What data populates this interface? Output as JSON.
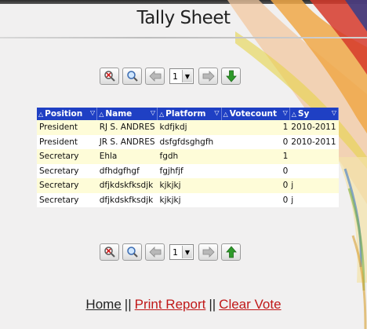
{
  "page": {
    "title": "Tally Sheet"
  },
  "toolbar": {
    "buttons": [
      "search-clear-icon",
      "search-icon",
      "prev-arrow-icon",
      "next-arrow-icon"
    ],
    "page_value": "1",
    "top_nav_icon": "down-arrow-icon",
    "bottom_nav_icon": "up-arrow-icon"
  },
  "table": {
    "columns": [
      "Position",
      "Name",
      "Platform",
      "Votecount",
      "Sy"
    ],
    "rows": [
      {
        "position": "President",
        "name": "RJ S. ANDRES",
        "platform": "kdfjkdj",
        "votecount": "1",
        "sy": "2010-2011"
      },
      {
        "position": "President",
        "name": "JR S. ANDRES",
        "platform": "dsfgfdsghgfh",
        "votecount": "0",
        "sy": "2010-2011"
      },
      {
        "position": "Secretary",
        "name": "Ehla",
        "platform": "fgdh",
        "votecount": "1",
        "sy": ""
      },
      {
        "position": "Secretary",
        "name": "dfhdgfhgf",
        "platform": "fgjhfjf",
        "votecount": "0",
        "sy": ""
      },
      {
        "position": "Secretary",
        "name": "dfjkdskfksdjk",
        "platform": "kjkjkj",
        "votecount": "0",
        "sy": "j"
      },
      {
        "position": "Secretary",
        "name": "dfjkdskfksdjk",
        "platform": "kjkjkj",
        "votecount": "0",
        "sy": "j"
      }
    ]
  },
  "links": {
    "home": "Home",
    "separator": "||",
    "print_report": "Print Report",
    "clear_vote": "Clear Vote"
  },
  "colors": {
    "header_bg": "#1f40c4",
    "row_odd": "#fefcd8",
    "link_red": "#c01818",
    "green_arrow": "#2e9a2a"
  }
}
